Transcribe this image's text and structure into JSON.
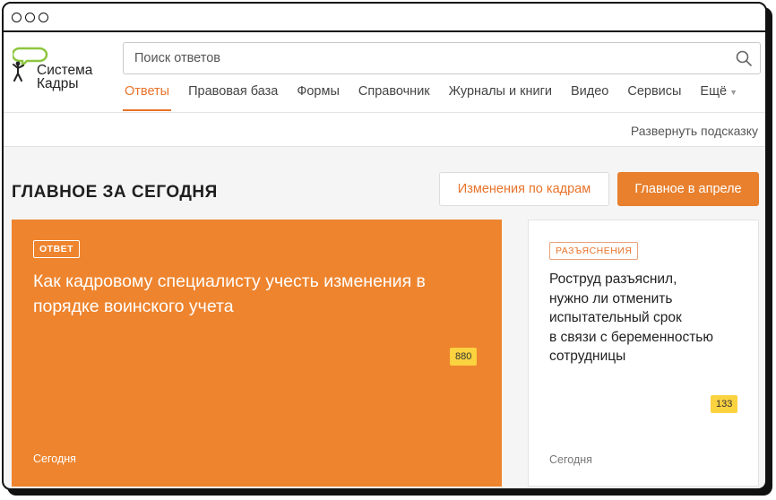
{
  "logo": {
    "line1": "Система",
    "line2": "Кадры",
    "colors": {
      "bubble": "#8dc63f",
      "figure": "#222222"
    }
  },
  "search": {
    "placeholder": "Поиск ответов",
    "value": ""
  },
  "nav": {
    "items": [
      {
        "label": "Ответы",
        "active": true
      },
      {
        "label": "Правовая база"
      },
      {
        "label": "Формы"
      },
      {
        "label": "Справочник"
      },
      {
        "label": "Журналы и книги"
      },
      {
        "label": "Видео"
      },
      {
        "label": "Сервисы"
      },
      {
        "label": "Ещё"
      }
    ]
  },
  "hint": {
    "label": "Развернуть подсказку"
  },
  "main": {
    "section_title": "ГЛАВНОЕ ЗА СЕГОДНЯ",
    "buttons": {
      "changes": "Изменения по кадрам",
      "april": "Главное в апреле"
    },
    "cards": [
      {
        "tag": "ОТВЕТ",
        "title": "Как кадровому специалисту учесть изменения в порядке воинского учета",
        "count": "880",
        "date": "Сегодня"
      },
      {
        "tag": "РАЗЪЯСНЕНИЯ",
        "title_lines": [
          "Роструд разъяснил,",
          "нужно ли отменить",
          "испытательный срок",
          "в связи с беременностью",
          "сотрудницы"
        ],
        "count": "133",
        "date": "Сегодня"
      }
    ]
  },
  "colors": {
    "accent": "#e8732a",
    "card_orange": "#ee842e",
    "badge_yellow": "#fbd23f"
  }
}
